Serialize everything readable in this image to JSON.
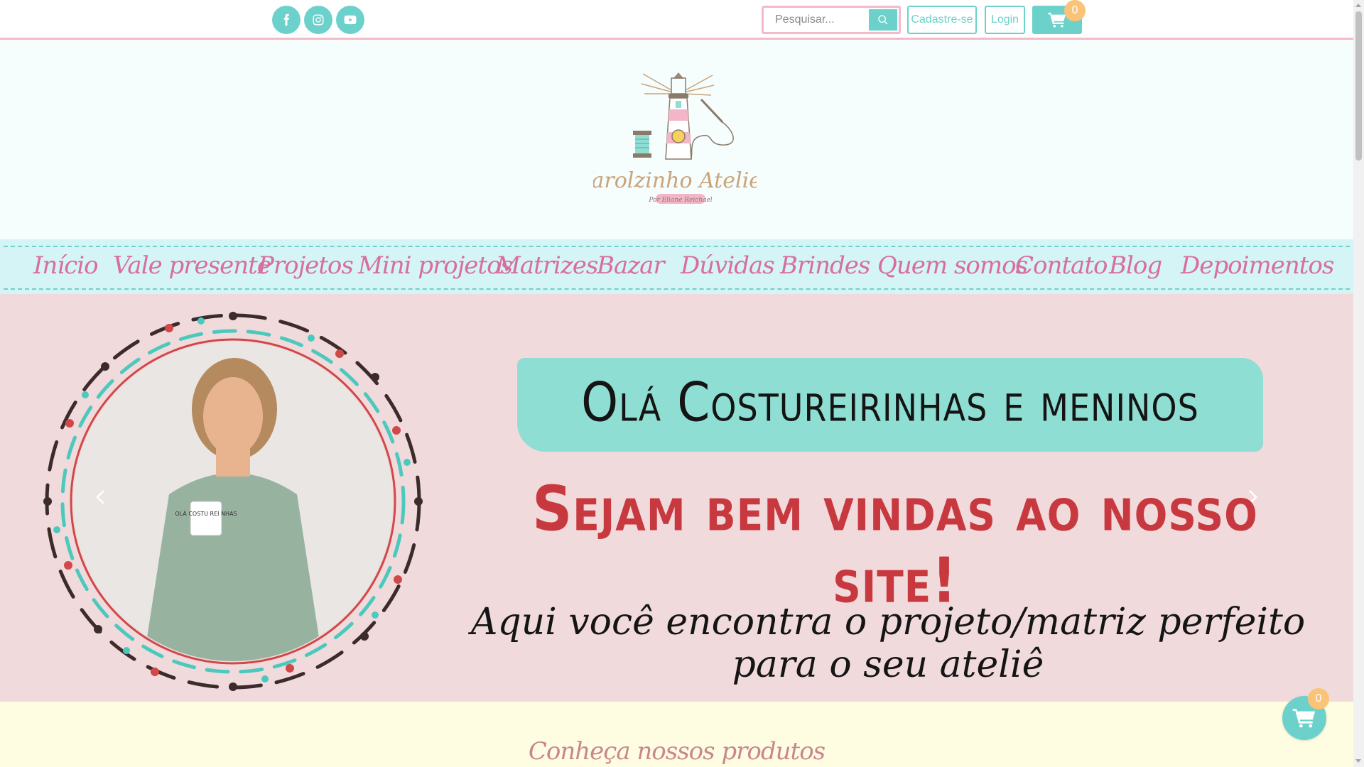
{
  "social": {
    "icons": [
      "facebook-icon",
      "instagram-icon",
      "youtube-icon"
    ]
  },
  "search": {
    "placeholder": "Pesquisar...",
    "button_icon": "search-icon"
  },
  "auth": {
    "register_label": "Cadastre-se",
    "login_label": "Login"
  },
  "cart": {
    "count": "0",
    "icon": "cart-icon"
  },
  "logo": {
    "name": "Farolzinho Atelier",
    "tagline": "Por Eliane Reichael"
  },
  "nav": {
    "items": [
      "Início",
      "Vale presente",
      "Projetos",
      "Mini projetos",
      "Matrizes",
      "Bazar",
      "Dúvidas",
      "Brindes",
      "Quem somos",
      "Contato",
      "Blog",
      "Depoimentos"
    ]
  },
  "hero": {
    "headline": "Olá Costureirinhas e meninos",
    "welcome": "Sejam bem vindas ao nosso site!",
    "subtitle": "Aqui você encontra o projeto/matriz perfeito para o seu ateliê",
    "mug_text": "OLÁ COSTU REI NHAS"
  },
  "products": {
    "title": "Conheça nossos produtos"
  },
  "floating_cart": {
    "count": "0"
  },
  "colors": {
    "teal": "#6cd1cb",
    "pink_border": "#f5b9cc",
    "nav_text": "#d86d9e",
    "hero_bg": "#f1dadc",
    "banner_teal": "#8fded3",
    "welcome_red": "#c8393f",
    "badge_orange": "#fbc378",
    "products_bg": "#fffde1"
  }
}
